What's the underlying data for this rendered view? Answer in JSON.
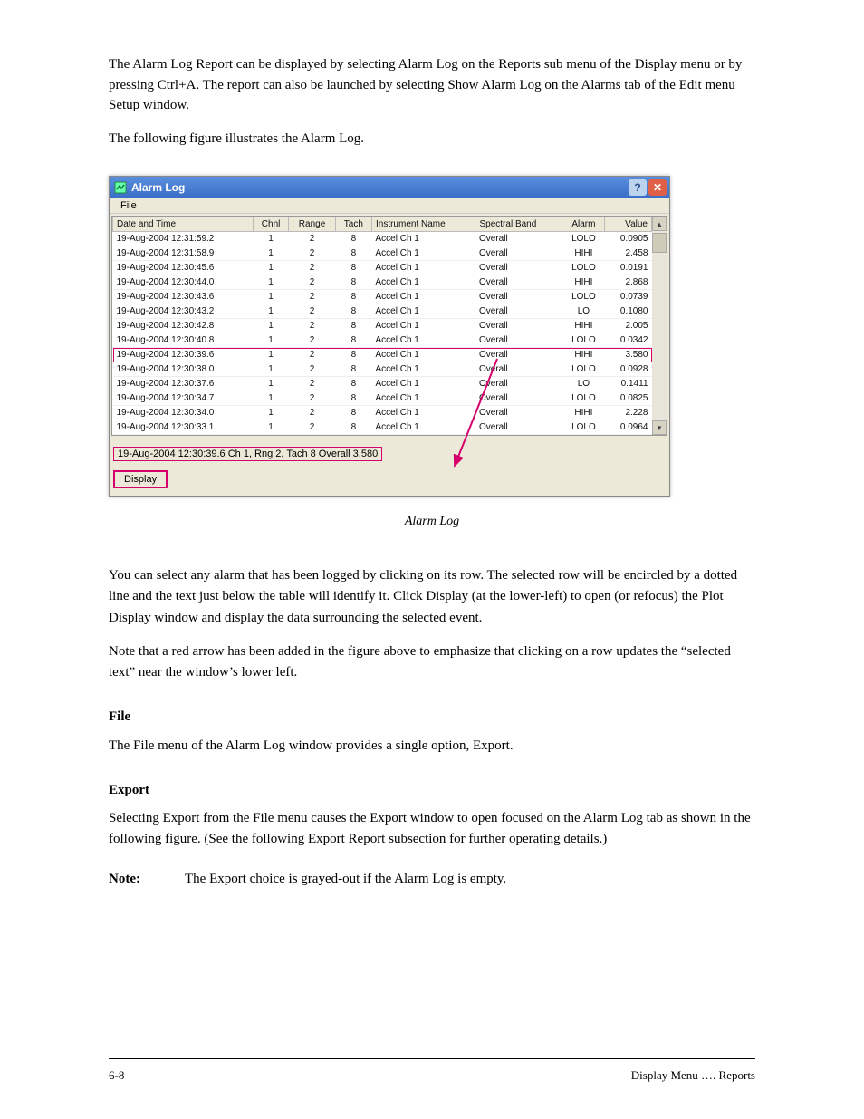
{
  "intro": {
    "p1": "The Alarm Log Report can be displayed by selecting Alarm Log on the Reports sub menu of the Display menu or by pressing Ctrl+A. The report can also be launched by selecting Show Alarm Log on the Alarms tab of the Edit menu Setup window.",
    "p2": "The following figure illustrates the Alarm Log."
  },
  "window": {
    "title": "Alarm Log",
    "menu_file": "File",
    "headers": [
      "Date and Time",
      "Chnl",
      "Range",
      "Tach",
      "Instrument Name",
      "Spectral Band",
      "Alarm",
      "Value"
    ],
    "rows": [
      {
        "dt": "19-Aug-2004 12:31:59.2",
        "ch": "1",
        "rng": "2",
        "tach": "8",
        "inst": "Accel Ch 1",
        "band": "Overall",
        "alarm": "LOLO",
        "val": "0.0905",
        "hl": false
      },
      {
        "dt": "19-Aug-2004 12:31:58.9",
        "ch": "1",
        "rng": "2",
        "tach": "8",
        "inst": "Accel Ch 1",
        "band": "Overall",
        "alarm": "HIHI",
        "val": "2.458",
        "hl": false
      },
      {
        "dt": "19-Aug-2004 12:30:45.6",
        "ch": "1",
        "rng": "2",
        "tach": "8",
        "inst": "Accel Ch 1",
        "band": "Overall",
        "alarm": "LOLO",
        "val": "0.0191",
        "hl": false
      },
      {
        "dt": "19-Aug-2004 12:30:44.0",
        "ch": "1",
        "rng": "2",
        "tach": "8",
        "inst": "Accel Ch 1",
        "band": "Overall",
        "alarm": "HIHI",
        "val": "2.868",
        "hl": false
      },
      {
        "dt": "19-Aug-2004 12:30:43.6",
        "ch": "1",
        "rng": "2",
        "tach": "8",
        "inst": "Accel Ch 1",
        "band": "Overall",
        "alarm": "LOLO",
        "val": "0.0739",
        "hl": false
      },
      {
        "dt": "19-Aug-2004 12:30:43.2",
        "ch": "1",
        "rng": "2",
        "tach": "8",
        "inst": "Accel Ch 1",
        "band": "Overall",
        "alarm": "LO",
        "val": "0.1080",
        "hl": false
      },
      {
        "dt": "19-Aug-2004 12:30:42.8",
        "ch": "1",
        "rng": "2",
        "tach": "8",
        "inst": "Accel Ch 1",
        "band": "Overall",
        "alarm": "HIHI",
        "val": "2.005",
        "hl": false
      },
      {
        "dt": "19-Aug-2004 12:30:40.8",
        "ch": "1",
        "rng": "2",
        "tach": "8",
        "inst": "Accel Ch 1",
        "band": "Overall",
        "alarm": "LOLO",
        "val": "0.0342",
        "hl": false
      },
      {
        "dt": "19-Aug-2004 12:30:39.6",
        "ch": "1",
        "rng": "2",
        "tach": "8",
        "inst": "Accel Ch 1",
        "band": "Overall",
        "alarm": "HIHI",
        "val": "3.580",
        "hl": true
      },
      {
        "dt": "19-Aug-2004 12:30:38.0",
        "ch": "1",
        "rng": "2",
        "tach": "8",
        "inst": "Accel Ch 1",
        "band": "Overall",
        "alarm": "LOLO",
        "val": "0.0928",
        "hl": false
      },
      {
        "dt": "19-Aug-2004 12:30:37.6",
        "ch": "1",
        "rng": "2",
        "tach": "8",
        "inst": "Accel Ch 1",
        "band": "Overall",
        "alarm": "LO",
        "val": "0.1411",
        "hl": false
      },
      {
        "dt": "19-Aug-2004 12:30:34.7",
        "ch": "1",
        "rng": "2",
        "tach": "8",
        "inst": "Accel Ch 1",
        "band": "Overall",
        "alarm": "LOLO",
        "val": "0.0825",
        "hl": false
      },
      {
        "dt": "19-Aug-2004 12:30:34.0",
        "ch": "1",
        "rng": "2",
        "tach": "8",
        "inst": "Accel Ch 1",
        "band": "Overall",
        "alarm": "HIHI",
        "val": "2.228",
        "hl": false
      },
      {
        "dt": "19-Aug-2004 12:30:33.1",
        "ch": "1",
        "rng": "2",
        "tach": "8",
        "inst": "Accel Ch 1",
        "band": "Overall",
        "alarm": "LOLO",
        "val": "0.0964",
        "hl": false
      }
    ],
    "status": "19-Aug-2004 12:30:39.6   Ch 1,  Rng 2,  Tach 8    Overall   3.580",
    "display_button": "Display"
  },
  "caption": "Alarm Log",
  "body": {
    "p1": "You can select any alarm that has been logged by clicking on its row. The selected row will be encircled by a dotted line and the text just below the table will identify it. Click Display (at the lower-left) to open (or refocus) the Plot Display window and display the data surrounding the selected event.",
    "p2": "Note that a red arrow has been added in the figure above to emphasize that clicking on a row updates the “selected text” near the window’s lower left.",
    "h_file": "File",
    "p3": "The File menu of the Alarm Log window provides a single option, Export.",
    "h_export": "Export",
    "p4": "Selecting Export from the File menu causes the Export window to open focused on the Alarm Log tab as shown in the following figure. (See the following Export Report subsection for further operating details.)",
    "note_label": "Note:",
    "note_text": "The Export choice is grayed-out if the Alarm Log is empty."
  },
  "footer": {
    "page": "6-8",
    "text": "Display Menu …. Reports"
  }
}
